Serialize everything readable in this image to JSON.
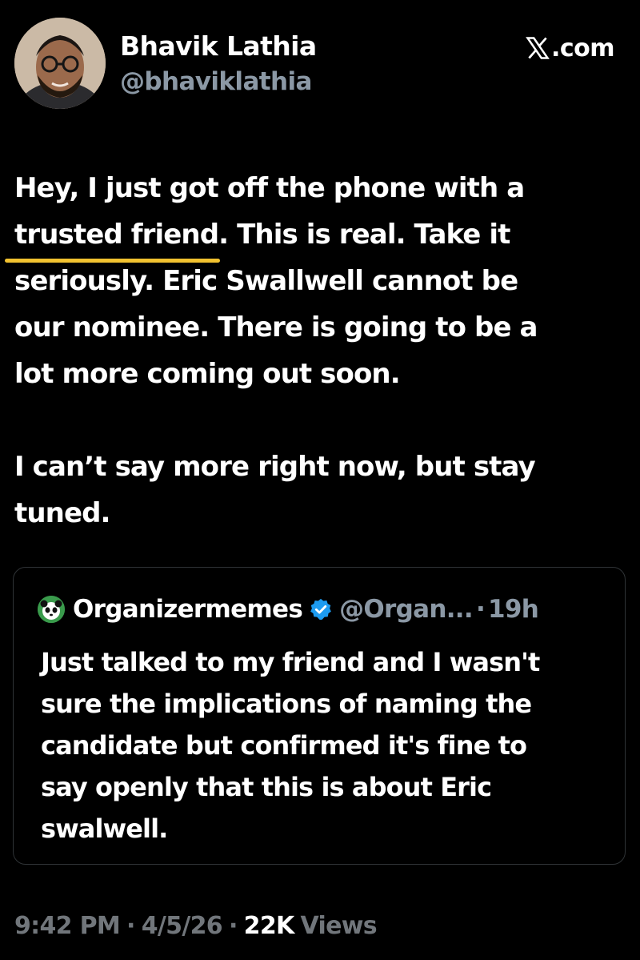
{
  "author": {
    "display_name": "Bhavik Lathia",
    "handle": "@bhaviklathia",
    "avatar_icon": "person-photo"
  },
  "site": {
    "label": ".com",
    "icon": "x-logo-icon"
  },
  "tweet": {
    "lines_p1": [
      "Hey, I just got off the phone with a",
      "trusted friend",
      ". This is real. Take it",
      "seriously. Eric Swallwell cannot be",
      "our nominee. There is going to be a",
      "lot more coming out soon."
    ],
    "lines_p2": [
      "I can’t say more right now, but stay",
      "tuned."
    ],
    "highlight_color": "#f2c230"
  },
  "quote": {
    "name": "Organizermemes",
    "handle": "@Organ...",
    "dot": "·",
    "time": "19h",
    "verified_color": "#1d9bf0",
    "avatar_icon": "panda-icon",
    "lines": [
      "Just talked to my friend and I wasn't",
      "sure the implications of naming the",
      "candidate but confirmed it's fine to",
      "say openly that this is about Eric",
      "swalwell."
    ]
  },
  "meta": {
    "time": "9:42 PM",
    "dot": "·",
    "date": "4/5/26",
    "views_count": "22K",
    "views_label": "Views"
  }
}
